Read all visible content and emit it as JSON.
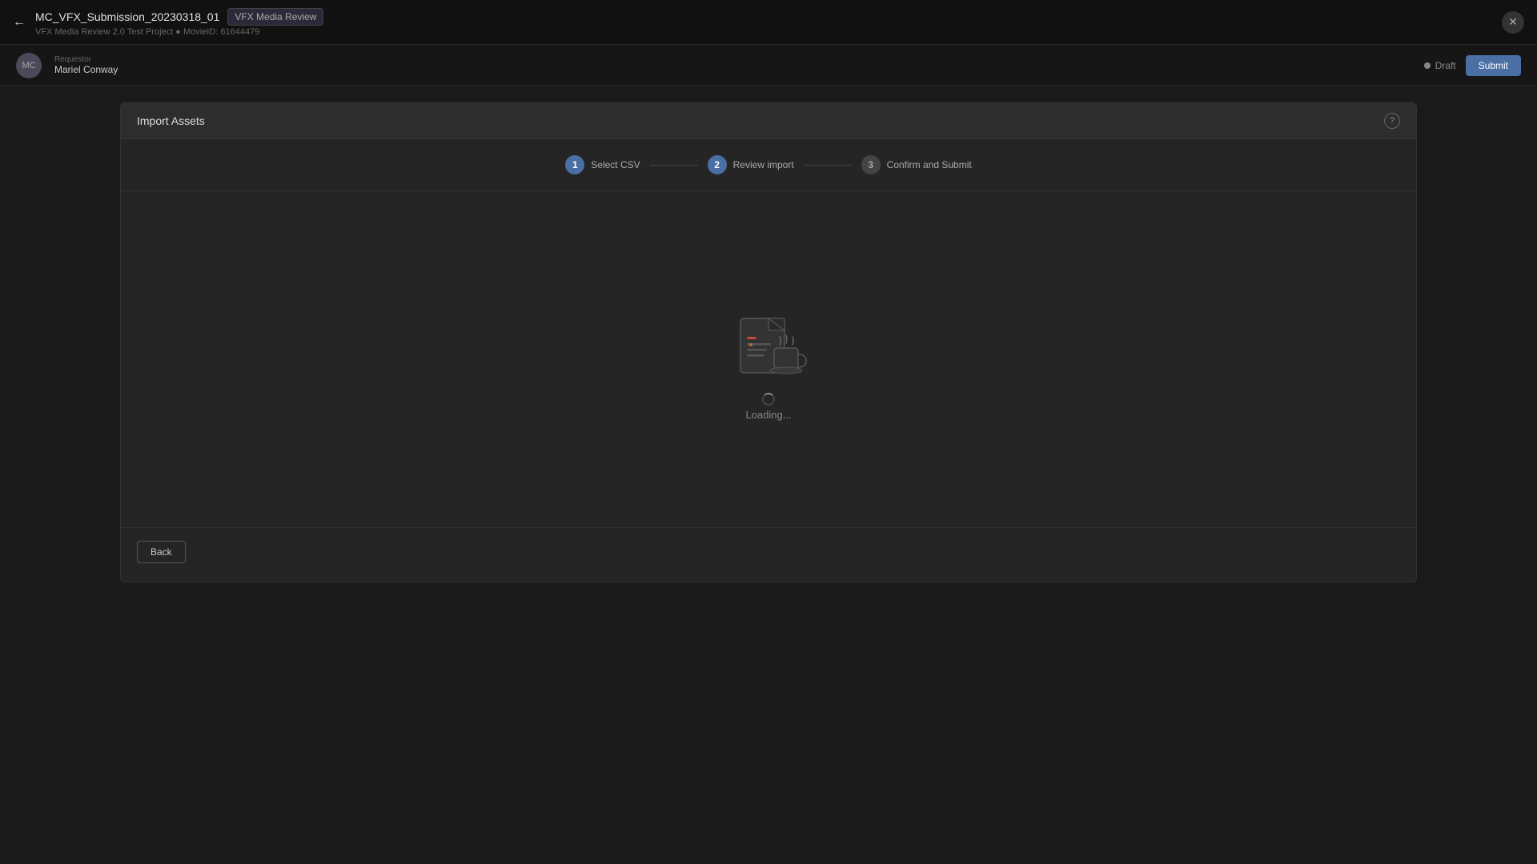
{
  "topbar": {
    "back_icon": "←",
    "project_name": "MC_VFX_Submission_20230318_01",
    "tag_label": "VFX Media Review",
    "subtitle": "VFX Media Review 2.0 Test Project  ●  MovieID: 61644479",
    "close_icon": "✕"
  },
  "subheader": {
    "requester_label": "Requestor",
    "requester_name": "Mariel Conway",
    "draft_label": "Draft",
    "submit_label": "Submit"
  },
  "dialog": {
    "title": "Import Assets",
    "help_icon": "?",
    "stepper": [
      {
        "number": "1",
        "label": "Select CSV",
        "state": "active"
      },
      {
        "number": "2",
        "label": "Review import",
        "state": "active"
      },
      {
        "number": "3",
        "label": "Confirm and Submit",
        "state": "inactive"
      }
    ],
    "loading_text": "Loading...",
    "footer": {
      "back_label": "Back"
    }
  }
}
